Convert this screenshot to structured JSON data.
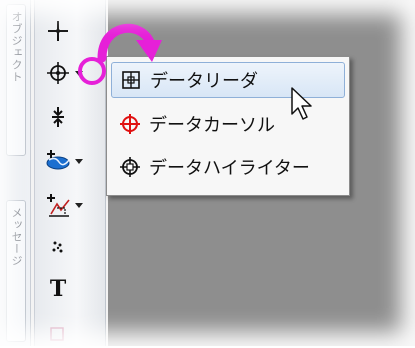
{
  "left_panel": {
    "tab_upper_text": "オブジェクト",
    "tab_lower_text": "メッセージ"
  },
  "toolbar": {
    "tools": [
      {
        "name": "crosshair-tool",
        "icon": "crosshair-icon"
      },
      {
        "name": "data-reader-tool",
        "icon": "data-reader-icon",
        "has_dropdown": true
      },
      {
        "name": "scale-tool",
        "icon": "scale-icon"
      },
      {
        "name": "region-select-tool",
        "icon": "region-icon",
        "has_dropdown": true
      },
      {
        "name": "mask-tool",
        "icon": "mask-icon",
        "has_dropdown": true
      },
      {
        "name": "scatter-tool",
        "icon": "scatter-icon"
      },
      {
        "name": "text-tool",
        "icon": "text-icon",
        "label": "T"
      }
    ]
  },
  "menu": {
    "items": [
      {
        "label": "データリーダ",
        "icon": "data-reader-icon",
        "highlighted": true
      },
      {
        "label": "データカーソル",
        "icon": "data-cursor-icon",
        "highlighted": false
      },
      {
        "label": "データハイライター",
        "icon": "data-highlighter-icon",
        "highlighted": false
      }
    ]
  },
  "colors": {
    "highlight": "#e620d8",
    "cursor_icon": "#e01010",
    "canvas": "#8e8e8e"
  }
}
